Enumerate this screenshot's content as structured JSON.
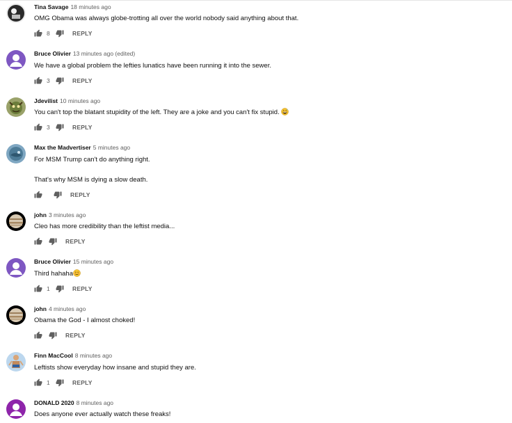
{
  "comments": [
    {
      "author": "Tina Savage",
      "time": "18 minutes ago",
      "lines": [
        "OMG Obama was always globe-trotting all over the world nobody said anything about that."
      ],
      "emoji": "",
      "likes": "8",
      "reply_label": "REPLY",
      "avatar": "tina-savage-avatar",
      "avatar_bg": "#8c8c8c"
    },
    {
      "author": "Bruce Olivier",
      "time": "13 minutes ago (edited)",
      "lines": [
        "We have a global problem the lefties lunatics have been running it into the sewer."
      ],
      "emoji": "",
      "likes": "3",
      "reply_label": "REPLY",
      "avatar": "default-user-avatar",
      "avatar_bg": "#7e57c2"
    },
    {
      "author": "Jdevilist",
      "time": "10 minutes ago",
      "lines": [
        "You can't top the blatant stupidity of the left. They are a joke and you can't fix stupid."
      ],
      "emoji": "grinning-sweat-emoji",
      "likes": "3",
      "reply_label": "REPLY",
      "avatar": "jdevilist-avatar",
      "avatar_bg": "#6b7d3a"
    },
    {
      "author": "Max the Madvertiser",
      "time": "5 minutes ago",
      "lines": [
        "For MSM Trump can't do anything right.",
        "That's why MSM is dying a slow death."
      ],
      "emoji": "",
      "likes": "",
      "reply_label": "REPLY",
      "avatar": "max-madvertiser-avatar",
      "avatar_bg": "#5d8aa8"
    },
    {
      "author": "john",
      "time": "3 minutes ago",
      "lines": [
        "Cleo has more credibility than the leftist media..."
      ],
      "emoji": "",
      "likes": "",
      "reply_label": "REPLY",
      "avatar": "jupiter-avatar",
      "avatar_bg": "#000000"
    },
    {
      "author": "Bruce Olivier",
      "time": "15 minutes ago",
      "lines": [
        "Third hahaha"
      ],
      "emoji": "smiling-emoji",
      "likes": "1",
      "reply_label": "REPLY",
      "avatar": "default-user-avatar",
      "avatar_bg": "#7e57c2"
    },
    {
      "author": "john",
      "time": "4 minutes ago",
      "lines": [
        "Obama the God - I almost choked!"
      ],
      "emoji": "",
      "likes": "",
      "reply_label": "REPLY",
      "avatar": "jupiter-avatar",
      "avatar_bg": "#000000"
    },
    {
      "author": "Finn MacCool",
      "time": "8 minutes ago",
      "lines": [
        "Leftists show everyday how insane and stupid they are."
      ],
      "emoji": "",
      "likes": "1",
      "reply_label": "REPLY",
      "avatar": "finn-maccool-avatar",
      "avatar_bg": "#a7c7e7"
    },
    {
      "author": "DONALD 2020",
      "time": "8 minutes ago",
      "lines": [
        "Does anyone ever actually watch these freaks!"
      ],
      "emoji": "",
      "likes": "",
      "reply_label": "REPLY",
      "avatar": "default-user-avatar",
      "avatar_bg": "#8e24aa"
    }
  ]
}
